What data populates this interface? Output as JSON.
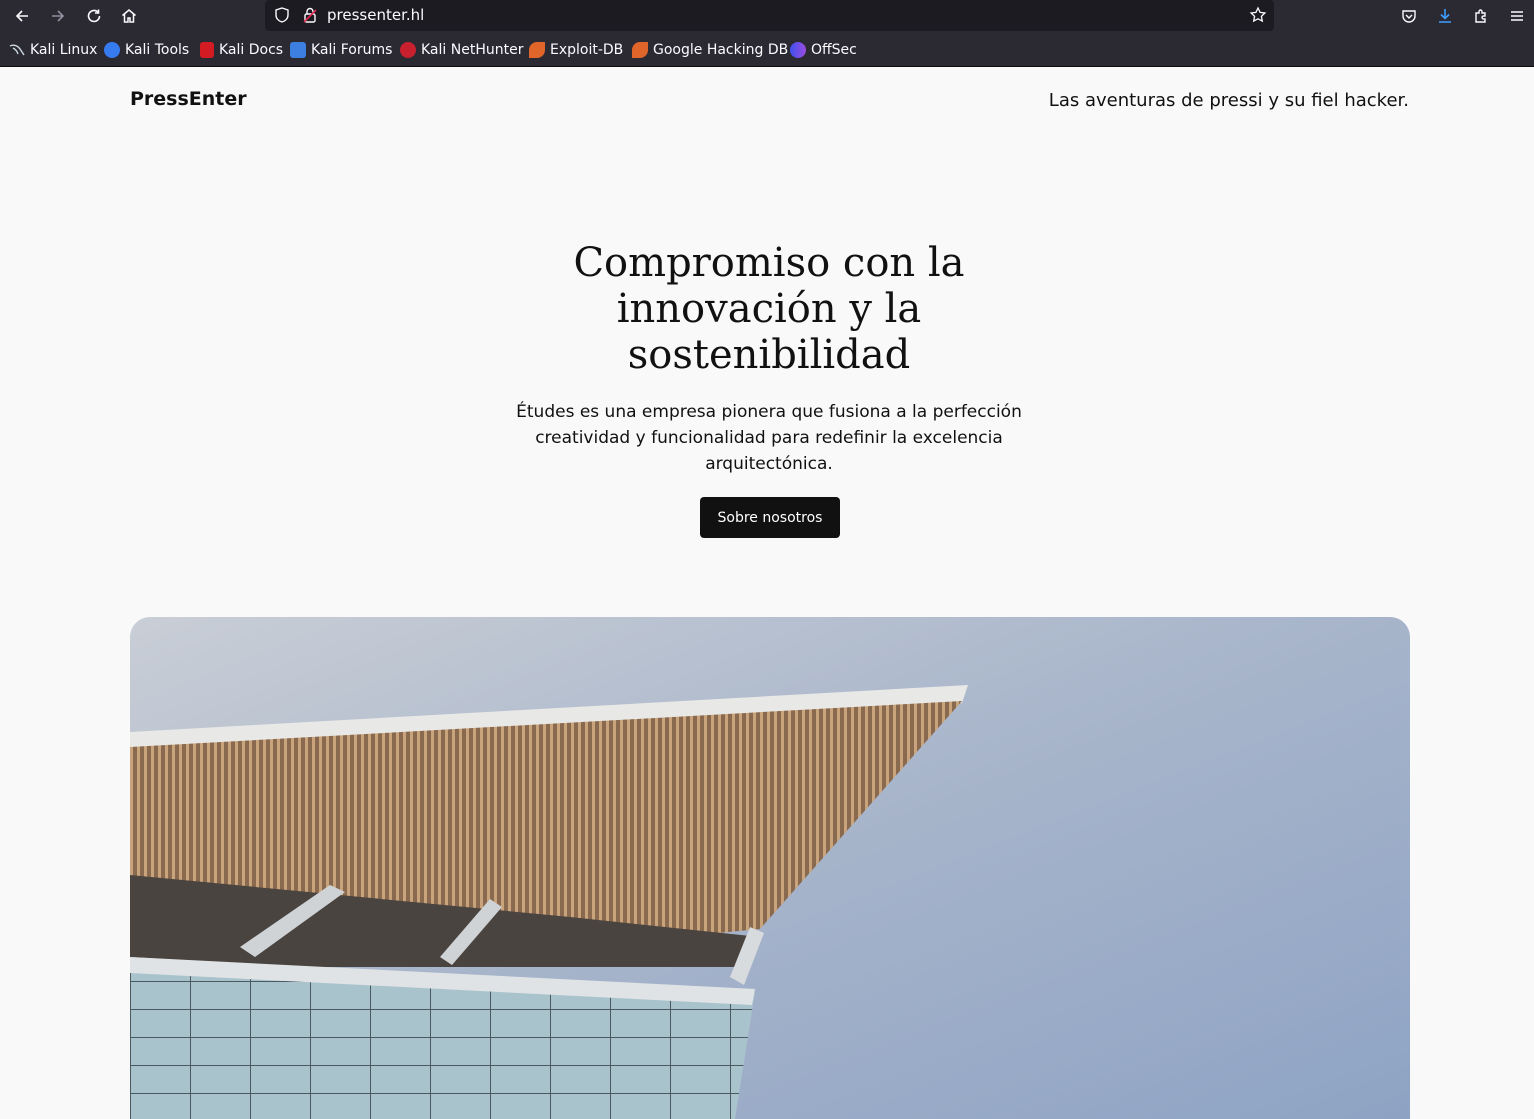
{
  "browser": {
    "url": "pressenter.hl",
    "bookmarks": [
      {
        "label": "Kali Linux",
        "icon": "kali-dragon-icon"
      },
      {
        "label": "Kali Tools",
        "icon": "kali-tools-icon"
      },
      {
        "label": "Kali Docs",
        "icon": "kali-docs-icon"
      },
      {
        "label": "Kali Forums",
        "icon": "kali-forums-icon"
      },
      {
        "label": "Kali NetHunter",
        "icon": "kali-nethunter-icon"
      },
      {
        "label": "Exploit-DB",
        "icon": "exploit-db-icon"
      },
      {
        "label": "Google Hacking DB",
        "icon": "exploit-db-icon"
      },
      {
        "label": "OffSec",
        "icon": "offsec-icon"
      }
    ]
  },
  "site": {
    "title": "PressEnter",
    "tagline": "Las aventuras de pressi y su fiel hacker."
  },
  "hero": {
    "heading": "Compromiso con la innovación y la sostenibilidad",
    "text": "Études es una empresa pionera que fusiona a la perfección creatividad y funcionalidad para redefinir la excelencia arquitectónica.",
    "button_label": "Sobre nosotros"
  },
  "colors": {
    "page_background": "#f9f9f9",
    "text": "#111111",
    "button_background": "#111111",
    "toolbar": "#2b2a33"
  }
}
